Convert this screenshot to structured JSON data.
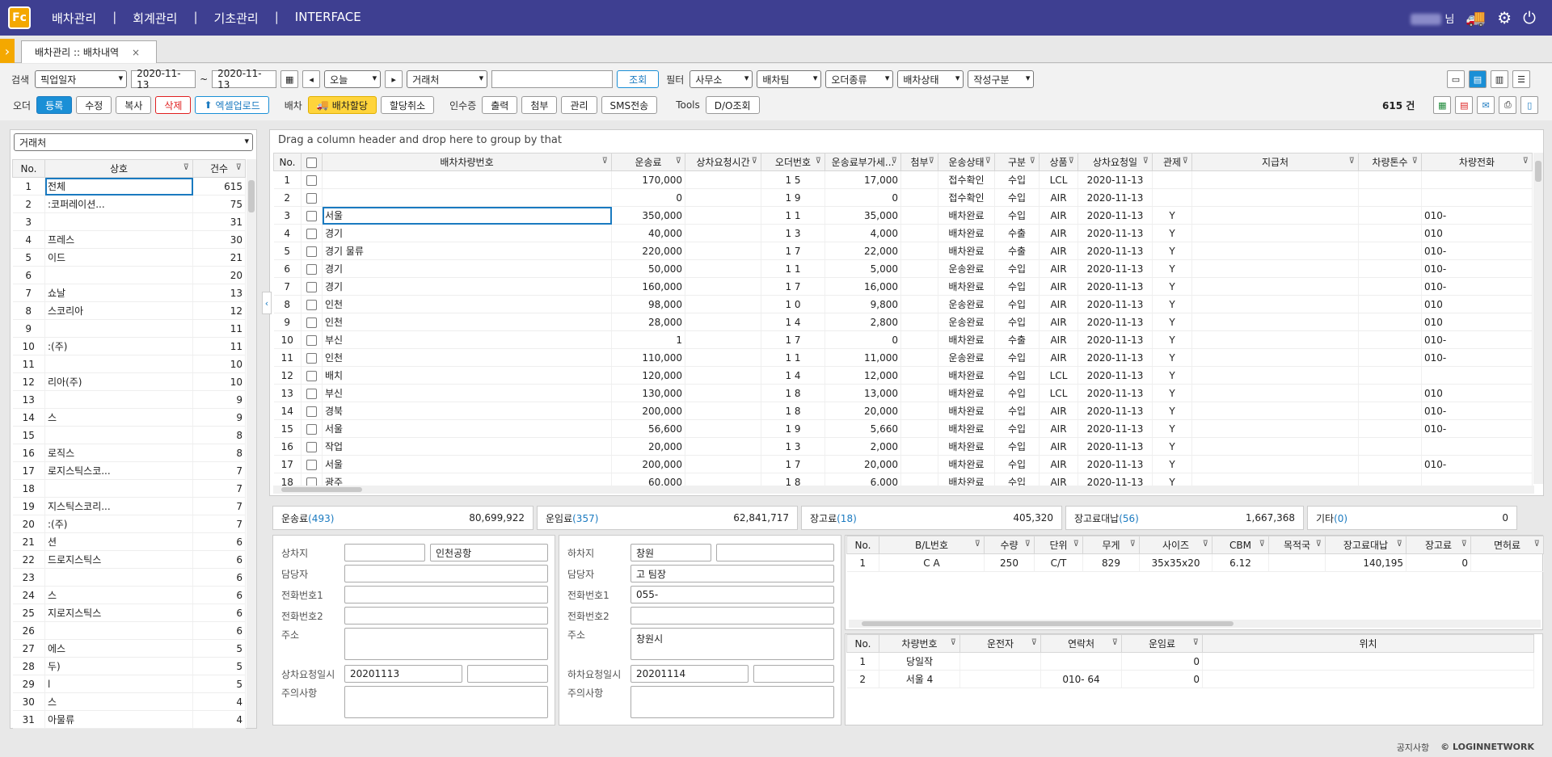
{
  "topbar": {
    "logo": "Fc",
    "menu": [
      "배차관리",
      "회계관리",
      "기초관리",
      "INTERFACE"
    ],
    "user_suffix": "님"
  },
  "tab": {
    "title": "배차관리 :: 배차내역",
    "close": "×"
  },
  "search": {
    "label": "검색",
    "date_type": "픽업일자",
    "date_from": "2020-11-13",
    "tilde": "~",
    "date_to": "2020-11-13",
    "period": "오늘",
    "partner_type": "거래처",
    "search_btn": "조회",
    "filter_label": "필터",
    "filters": [
      "사무소",
      "배차팀",
      "오더종류",
      "배차상태",
      "작성구분"
    ]
  },
  "order": {
    "label": "오더",
    "register": "등록",
    "edit": "수정",
    "copy": "복사",
    "delete": "삭제",
    "excel_upload": "엑셀업로드"
  },
  "dispatch": {
    "label": "배차",
    "assign": "배차할당",
    "cancel": "할당취소"
  },
  "receipt": {
    "label": "인수증",
    "print": "출력",
    "attach": "첨부",
    "manage": "관리",
    "sms": "SMS전송"
  },
  "tools": {
    "label": "Tools",
    "do": "D/O조회"
  },
  "count": "615 건",
  "left_panel": {
    "select": "거래처",
    "headers": [
      "No.",
      "상호",
      "건수"
    ],
    "rows": [
      {
        "no": "1",
        "name": "전체",
        "count": "615"
      },
      {
        "no": "2",
        "name": ":코퍼레이션...",
        "count": "75"
      },
      {
        "no": "3",
        "name": "",
        "count": "31"
      },
      {
        "no": "4",
        "name": "프레스",
        "count": "30"
      },
      {
        "no": "5",
        "name": "이드",
        "count": "21"
      },
      {
        "no": "6",
        "name": "",
        "count": "20"
      },
      {
        "no": "7",
        "name": "쇼날",
        "count": "13"
      },
      {
        "no": "8",
        "name": "스코리아",
        "count": "12"
      },
      {
        "no": "9",
        "name": "",
        "count": "11"
      },
      {
        "no": "10",
        "name": ":(주)",
        "count": "11"
      },
      {
        "no": "11",
        "name": "",
        "count": "10"
      },
      {
        "no": "12",
        "name": "리아(주)",
        "count": "10"
      },
      {
        "no": "13",
        "name": "",
        "count": "9"
      },
      {
        "no": "14",
        "name": "스",
        "count": "9"
      },
      {
        "no": "15",
        "name": "",
        "count": "8"
      },
      {
        "no": "16",
        "name": "로직스",
        "count": "8"
      },
      {
        "no": "17",
        "name": "로지스틱스코...",
        "count": "7"
      },
      {
        "no": "18",
        "name": "",
        "count": "7"
      },
      {
        "no": "19",
        "name": "지스틱스코리...",
        "count": "7"
      },
      {
        "no": "20",
        "name": ":(주)",
        "count": "7"
      },
      {
        "no": "21",
        "name": "션",
        "count": "6"
      },
      {
        "no": "22",
        "name": "드로지스틱스",
        "count": "6"
      },
      {
        "no": "23",
        "name": "",
        "count": "6"
      },
      {
        "no": "24",
        "name": "스",
        "count": "6"
      },
      {
        "no": "25",
        "name": "지로지스틱스",
        "count": "6"
      },
      {
        "no": "26",
        "name": "",
        "count": "6"
      },
      {
        "no": "27",
        "name": "에스",
        "count": "5"
      },
      {
        "no": "28",
        "name": "두)",
        "count": "5"
      },
      {
        "no": "29",
        "name": "l",
        "count": "5"
      },
      {
        "no": "30",
        "name": "스",
        "count": "4"
      },
      {
        "no": "31",
        "name": "아물류",
        "count": "4"
      }
    ]
  },
  "main_grid": {
    "group_hint": "Drag a column header and drop here to group by that",
    "headers": [
      "No.",
      "",
      "배차차량번호",
      "운송료",
      "상차요청시간",
      "오더번호",
      "운송료부가세...",
      "첨부",
      "운송상태",
      "구분",
      "상품",
      "상차요청일",
      "관제",
      "지급처",
      "차량톤수",
      "차량전화"
    ],
    "rows": [
      {
        "no": "1",
        "car": "",
        "fee": "170,000",
        "ord": "1 5",
        "vat": "17,000",
        "status": "접수확인",
        "div": "수입",
        "prod": "LCL",
        "date": "2020-11-13",
        "ctl": "",
        "phone": ""
      },
      {
        "no": "2",
        "car": "",
        "fee": "0",
        "ord": "1 9",
        "vat": "0",
        "status": "접수확인",
        "div": "수입",
        "prod": "AIR",
        "date": "2020-11-13",
        "ctl": "",
        "phone": ""
      },
      {
        "no": "3",
        "car": "서울",
        "fee": "350,000",
        "ord": "1 1",
        "vat": "35,000",
        "status": "배차완료",
        "div": "수입",
        "prod": "AIR",
        "date": "2020-11-13",
        "ctl": "Y",
        "phone": "010-"
      },
      {
        "no": "4",
        "car": "경기",
        "fee": "40,000",
        "ord": "1 3",
        "vat": "4,000",
        "status": "배차완료",
        "div": "수출",
        "prod": "AIR",
        "date": "2020-11-13",
        "ctl": "Y",
        "phone": "010"
      },
      {
        "no": "5",
        "car": "경기 물류",
        "fee": "220,000",
        "ord": "1 7",
        "vat": "22,000",
        "status": "배차완료",
        "div": "수출",
        "prod": "AIR",
        "date": "2020-11-13",
        "ctl": "Y",
        "phone": "010-"
      },
      {
        "no": "6",
        "car": "경기",
        "fee": "50,000",
        "ord": "1 1",
        "vat": "5,000",
        "status": "운송완료",
        "div": "수입",
        "prod": "AIR",
        "date": "2020-11-13",
        "ctl": "Y",
        "phone": "010-"
      },
      {
        "no": "7",
        "car": "경기",
        "fee": "160,000",
        "ord": "1 7",
        "vat": "16,000",
        "status": "배차완료",
        "div": "수입",
        "prod": "AIR",
        "date": "2020-11-13",
        "ctl": "Y",
        "phone": "010-"
      },
      {
        "no": "8",
        "car": "인천",
        "fee": "98,000",
        "ord": "1 0",
        "vat": "9,800",
        "status": "운송완료",
        "div": "수입",
        "prod": "AIR",
        "date": "2020-11-13",
        "ctl": "Y",
        "phone": "010"
      },
      {
        "no": "9",
        "car": "인천",
        "fee": "28,000",
        "ord": "1 4",
        "vat": "2,800",
        "status": "운송완료",
        "div": "수입",
        "prod": "AIR",
        "date": "2020-11-13",
        "ctl": "Y",
        "phone": "010"
      },
      {
        "no": "10",
        "car": "부신",
        "fee": "1",
        "ord": "1 7",
        "vat": "0",
        "status": "배차완료",
        "div": "수출",
        "prod": "AIR",
        "date": "2020-11-13",
        "ctl": "Y",
        "phone": "010-"
      },
      {
        "no": "11",
        "car": "인천",
        "fee": "110,000",
        "ord": "1 1",
        "vat": "11,000",
        "status": "운송완료",
        "div": "수입",
        "prod": "AIR",
        "date": "2020-11-13",
        "ctl": "Y",
        "phone": "010-"
      },
      {
        "no": "12",
        "car": "배치",
        "fee": "120,000",
        "ord": "1 4",
        "vat": "12,000",
        "status": "배차완료",
        "div": "수입",
        "prod": "LCL",
        "date": "2020-11-13",
        "ctl": "Y",
        "phone": ""
      },
      {
        "no": "13",
        "car": "부신",
        "fee": "130,000",
        "ord": "1 8",
        "vat": "13,000",
        "status": "배차완료",
        "div": "수입",
        "prod": "LCL",
        "date": "2020-11-13",
        "ctl": "Y",
        "phone": "010"
      },
      {
        "no": "14",
        "car": "경북",
        "fee": "200,000",
        "ord": "1 8",
        "vat": "20,000",
        "status": "배차완료",
        "div": "수입",
        "prod": "AIR",
        "date": "2020-11-13",
        "ctl": "Y",
        "phone": "010-"
      },
      {
        "no": "15",
        "car": "서울",
        "fee": "56,600",
        "ord": "1 9",
        "vat": "5,660",
        "status": "배차완료",
        "div": "수입",
        "prod": "AIR",
        "date": "2020-11-13",
        "ctl": "Y",
        "phone": "010-"
      },
      {
        "no": "16",
        "car": "작업",
        "fee": "20,000",
        "ord": "1 3",
        "vat": "2,000",
        "status": "배차완료",
        "div": "수입",
        "prod": "AIR",
        "date": "2020-11-13",
        "ctl": "Y",
        "phone": ""
      },
      {
        "no": "17",
        "car": "서울",
        "fee": "200,000",
        "ord": "1 7",
        "vat": "20,000",
        "status": "배차완료",
        "div": "수입",
        "prod": "AIR",
        "date": "2020-11-13",
        "ctl": "Y",
        "phone": "010-"
      },
      {
        "no": "18",
        "car": "광주",
        "fee": "60,000",
        "ord": "1 8",
        "vat": "6,000",
        "status": "배차완료",
        "div": "수입",
        "prod": "AIR",
        "date": "2020-11-13",
        "ctl": "Y",
        "phone": ""
      }
    ]
  },
  "summary": [
    {
      "label": "운송료",
      "count": "(493)",
      "value": "80,699,922"
    },
    {
      "label": "운임료",
      "count": "(357)",
      "value": "62,841,717"
    },
    {
      "label": "장고료",
      "count": "(18)",
      "value": "405,320"
    },
    {
      "label": "장고료대납",
      "count": "(56)",
      "value": "1,667,368"
    },
    {
      "label": "기타",
      "count": "(0)",
      "value": "0"
    }
  ],
  "load": {
    "place_label": "상차지",
    "place_value": "인천공항",
    "manager_label": "담당자",
    "tel1_label": "전화번호1",
    "tel2_label": "전화번호2",
    "addr_label": "주소",
    "date_label": "상차요청일시",
    "date_value": "20201113",
    "note_label": "주의사항"
  },
  "unload": {
    "place_label": "하차지",
    "place_value": "창원",
    "manager_label": "담당자",
    "manager_value": "고 팀장",
    "tel1_label": "전화번호1",
    "tel1_value": "055-",
    "tel2_label": "전화번호2",
    "addr_label": "주소",
    "addr_value": "창원시",
    "date_label": "하차요청일시",
    "date_value": "20201114",
    "note_label": "주의사항"
  },
  "bl_grid": {
    "headers": [
      "No.",
      "B/L번호",
      "수량",
      "단위",
      "무게",
      "사이즈",
      "CBM",
      "목적국",
      "장고료대납",
      "장고료",
      "면허료"
    ],
    "row": {
      "no": "1",
      "bl": "C A",
      "qty": "250",
      "unit": "C/T",
      "weight": "829",
      "size": "35x35x20",
      "cbm": "6.12",
      "dest": "",
      "adv": "140,195",
      "fee": "0",
      "lic": ""
    }
  },
  "car_grid": {
    "headers": [
      "No.",
      "차량번호",
      "운전자",
      "연락처",
      "운임료",
      "위치"
    ],
    "rows": [
      {
        "no": "1",
        "car": "당일작",
        "driver": "",
        "tel": "",
        "fee": "0",
        "loc": ""
      },
      {
        "no": "2",
        "car": "서울 4",
        "driver": "",
        "tel": "010- 64",
        "fee": "0",
        "loc": ""
      }
    ]
  },
  "footer": {
    "notice": "공지사항",
    "copy": "© LOGINNETWORK"
  }
}
